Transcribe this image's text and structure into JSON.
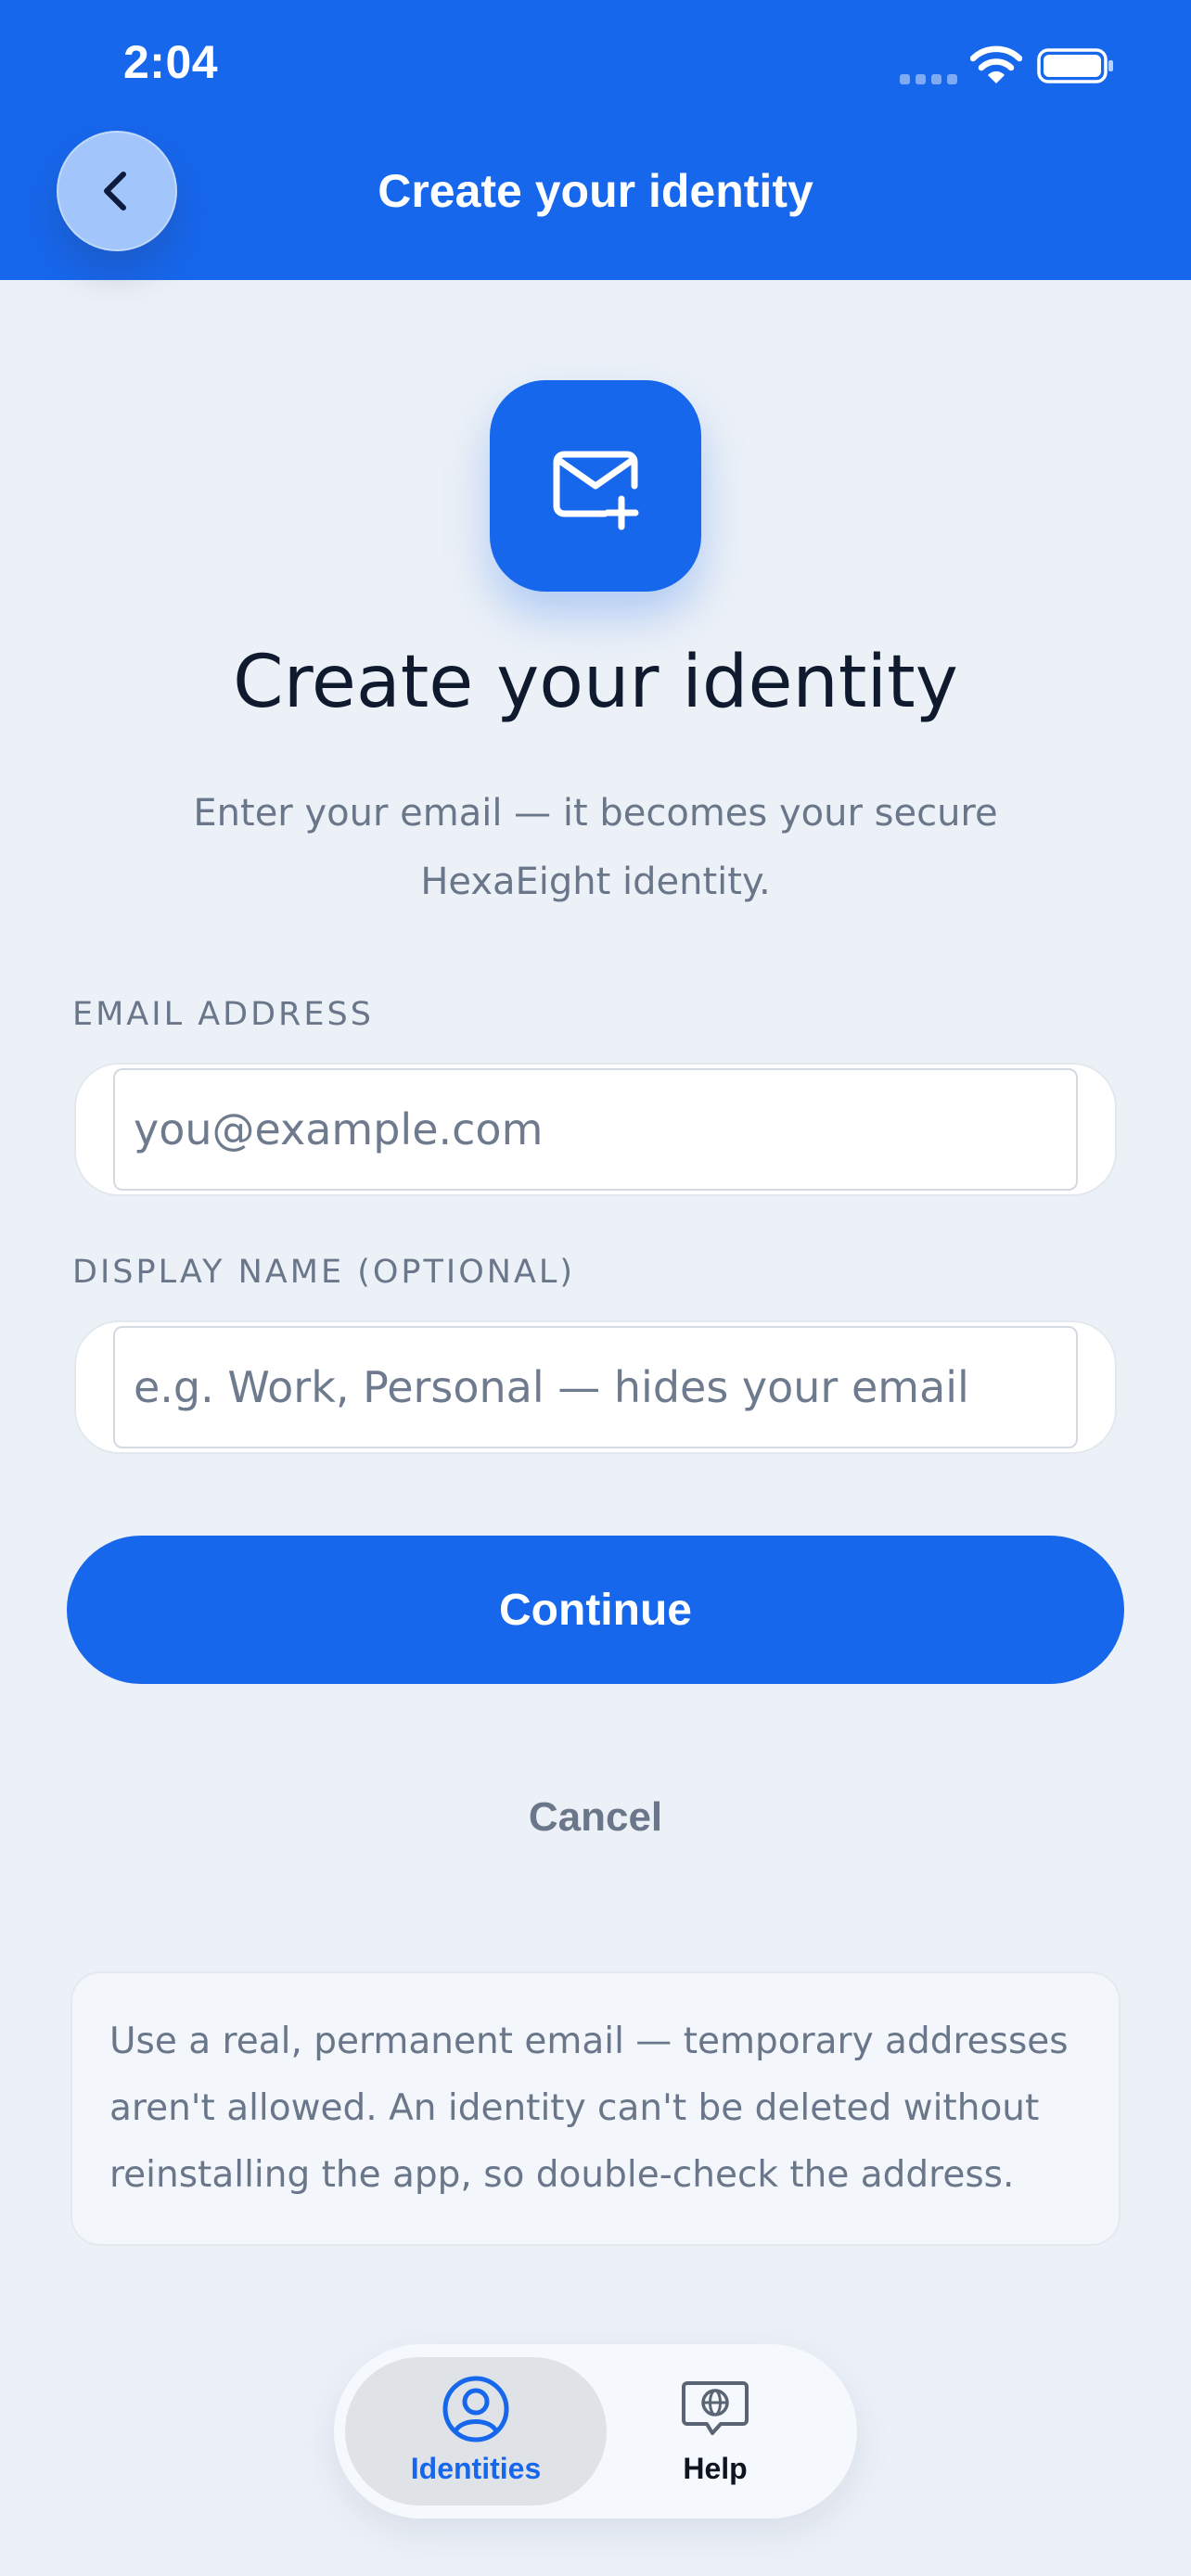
{
  "status_bar": {
    "time": "2:04"
  },
  "header": {
    "title": "Create your identity"
  },
  "hero": {
    "icon": "mail-plus-icon",
    "title": "Create your identity",
    "subtitle": "Enter your email — it becomes your secure HexaEight identity."
  },
  "form": {
    "email": {
      "label": "EMAIL ADDRESS",
      "placeholder": "you@example.com",
      "value": ""
    },
    "display_name": {
      "label": "DISPLAY NAME (OPTIONAL)",
      "placeholder": "e.g. Work, Personal — hides your email",
      "value": ""
    }
  },
  "actions": {
    "continue_label": "Continue",
    "cancel_label": "Cancel"
  },
  "notice": {
    "text": "Use a real, permanent email — temporary addresses aren't allowed. An identity can't be deleted without reinstalling the app, so double-check the address."
  },
  "tab_bar": {
    "items": [
      {
        "label": "Identities",
        "icon": "person-circle-icon",
        "active": true
      },
      {
        "label": "Help",
        "icon": "help-chat-globe-icon",
        "active": false
      }
    ]
  },
  "colors": {
    "accent": "#1767EC",
    "background": "#ECF1F7",
    "muted_text": "#6A7689",
    "dark_text": "#101A2E",
    "back_button": "#A2C5FB",
    "active_tab_label": "#1767EC"
  }
}
